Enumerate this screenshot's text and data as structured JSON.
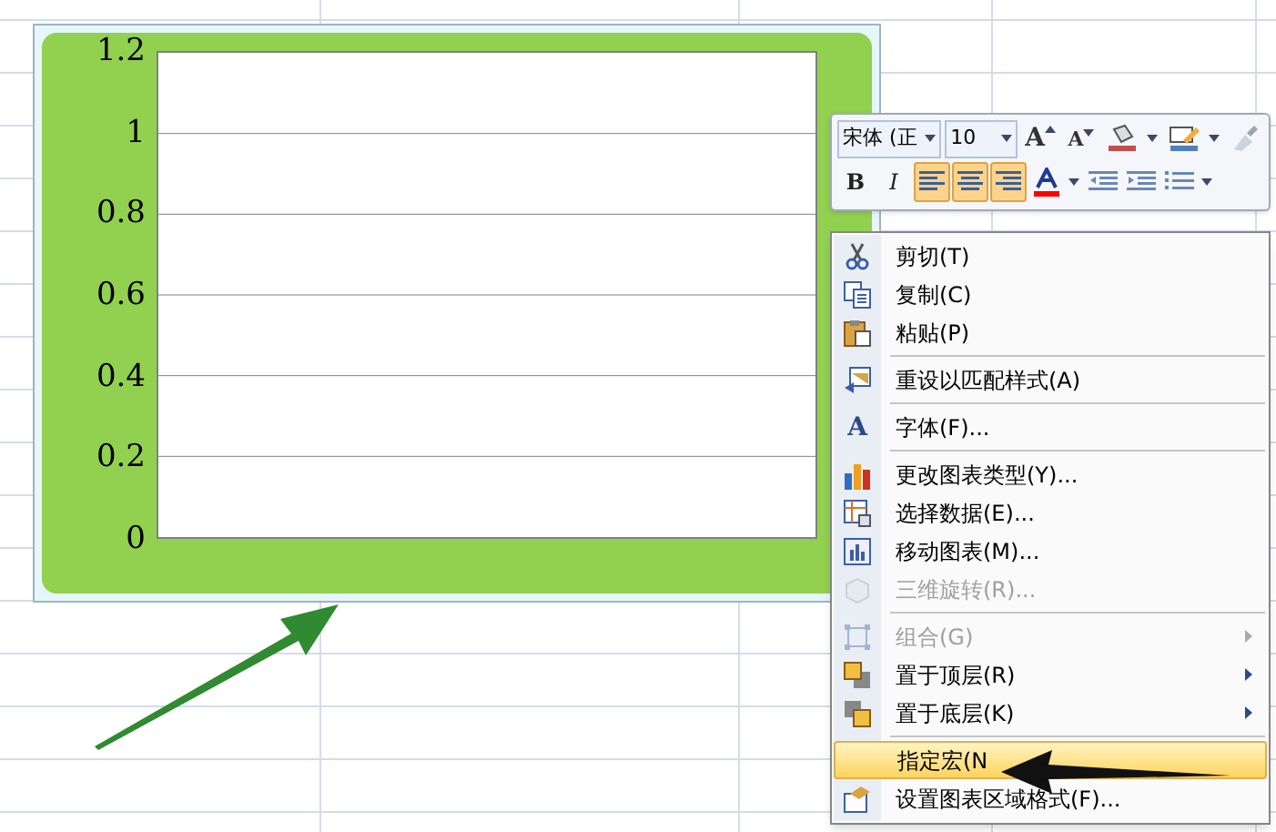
{
  "chart": {
    "y_axis_labels": [
      "1.2",
      "1",
      "0.8",
      "0.6",
      "0.4",
      "0.2",
      "0"
    ],
    "selected": true
  },
  "mini_toolbar": {
    "font_name": "宋体 (正",
    "font_size": "10",
    "buttons": [
      {
        "kind": "grow-font",
        "label": "A",
        "selected": false
      },
      {
        "kind": "shrink-font",
        "label": "A",
        "selected": false
      },
      {
        "kind": "fill-color",
        "selected": false
      },
      {
        "kind": "line-color",
        "selected": false
      },
      {
        "kind": "format-painter",
        "selected": false
      },
      {
        "kind": "bold",
        "label": "B",
        "selected": false
      },
      {
        "kind": "italic",
        "label": "I",
        "selected": false
      },
      {
        "kind": "align-left",
        "selected": true
      },
      {
        "kind": "align-center",
        "selected": true
      },
      {
        "kind": "align-right",
        "selected": true
      },
      {
        "kind": "font-color",
        "selected": false
      },
      {
        "kind": "decrease-indent",
        "selected": false
      },
      {
        "kind": "increase-indent",
        "selected": false
      },
      {
        "kind": "bullets",
        "selected": false
      }
    ]
  },
  "context_menu": [
    {
      "kind": "cut",
      "label": "剪切(T)",
      "disabled": false,
      "submenu": false,
      "selected": false
    },
    {
      "kind": "copy",
      "label": "复制(C)",
      "disabled": false,
      "submenu": false,
      "selected": false
    },
    {
      "kind": "paste",
      "label": "粘贴(P)",
      "disabled": false,
      "submenu": false,
      "selected": false
    },
    {
      "kind": "separator"
    },
    {
      "kind": "reset",
      "label": "重设以匹配样式(A)",
      "disabled": false,
      "submenu": false,
      "selected": false
    },
    {
      "kind": "separator"
    },
    {
      "kind": "font",
      "glyph": "A",
      "label": "字体(F)...",
      "disabled": false,
      "submenu": false,
      "selected": false
    },
    {
      "kind": "separator"
    },
    {
      "kind": "chart",
      "label": "更改图表类型(Y)...",
      "disabled": false,
      "submenu": false,
      "selected": false
    },
    {
      "kind": "data",
      "label": "选择数据(E)...",
      "disabled": false,
      "submenu": false,
      "selected": false
    },
    {
      "kind": "move",
      "label": "移动图表(M)...",
      "disabled": false,
      "submenu": false,
      "selected": false
    },
    {
      "kind": "cube",
      "label": "三维旋转(R)...",
      "disabled": true,
      "submenu": false,
      "selected": false
    },
    {
      "kind": "separator"
    },
    {
      "kind": "group",
      "label": "组合(G)",
      "disabled": true,
      "submenu": true,
      "selected": false
    },
    {
      "kind": "front",
      "label": "置于顶层(R)",
      "disabled": false,
      "submenu": true,
      "selected": false
    },
    {
      "kind": "back",
      "label": "置于底层(K)",
      "disabled": false,
      "submenu": true,
      "selected": false
    },
    {
      "kind": "separator"
    },
    {
      "kind": "macro",
      "label": "指定宏(N",
      "disabled": false,
      "submenu": false,
      "selected": true
    },
    {
      "kind": "format",
      "label": "设置图表区域格式(F)...",
      "disabled": false,
      "submenu": false,
      "selected": false
    }
  ]
}
